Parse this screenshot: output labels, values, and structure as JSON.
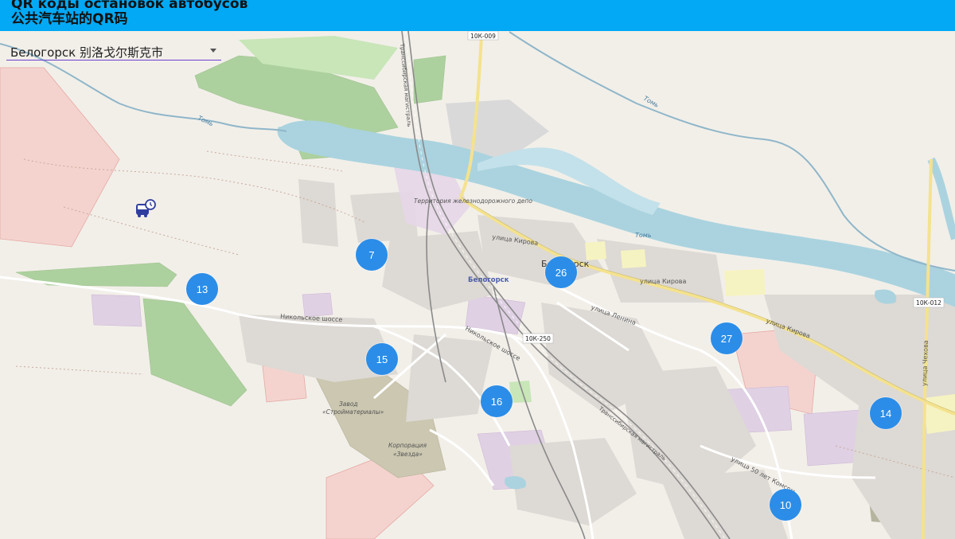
{
  "header": {
    "title_ru": "QR коды остановок автобусов",
    "title_zh": "公共汽车站的QR码"
  },
  "city_select": {
    "value": "Белогорск  别洛戈尔斯克市",
    "arrow_icon": "caret-down-icon"
  },
  "map": {
    "labels": {
      "city": "Белогорск",
      "city_short": "Белогорск",
      "station": "Белогорск",
      "road_10k009": "10К-009",
      "road_10k012": "10К-012",
      "road_10k250": "10К-250",
      "river_tom_1": "Томь",
      "river_tom_2": "Томь",
      "river_tom_3": "Томь",
      "street_kirova_1": "улица Кирова",
      "street_kirova_2": "улица Кирова",
      "street_kirova_3": "улица Кирова",
      "street_lenina": "улица Ленина",
      "street_chekhova": "улица Чехова",
      "street_50let": "улица 50 лет Комсом",
      "street_nikolskoe_1": "Никольское шоссе",
      "street_nikolskoe_2": "Никольское шоссе",
      "rail_transsib_1": "Транссибирская магистраль",
      "rail_transsib_2": "Транссибирская магистраль",
      "rail_depot": "Территория железнодорожного депо",
      "factory_1": "Завод",
      "factory_2": "«Стройматериалы»",
      "corp_1": "Корпорация",
      "corp_2": "«Звезда»"
    },
    "bus_stop_icon": "bus-stop-icon",
    "clusters": [
      "7",
      "13",
      "26",
      "27",
      "15",
      "16",
      "14",
      "10"
    ]
  },
  "colors": {
    "header": "#03a9f4",
    "cluster": "#2b8de8",
    "water": "#aad3df",
    "map_background": "#f2efe9"
  }
}
